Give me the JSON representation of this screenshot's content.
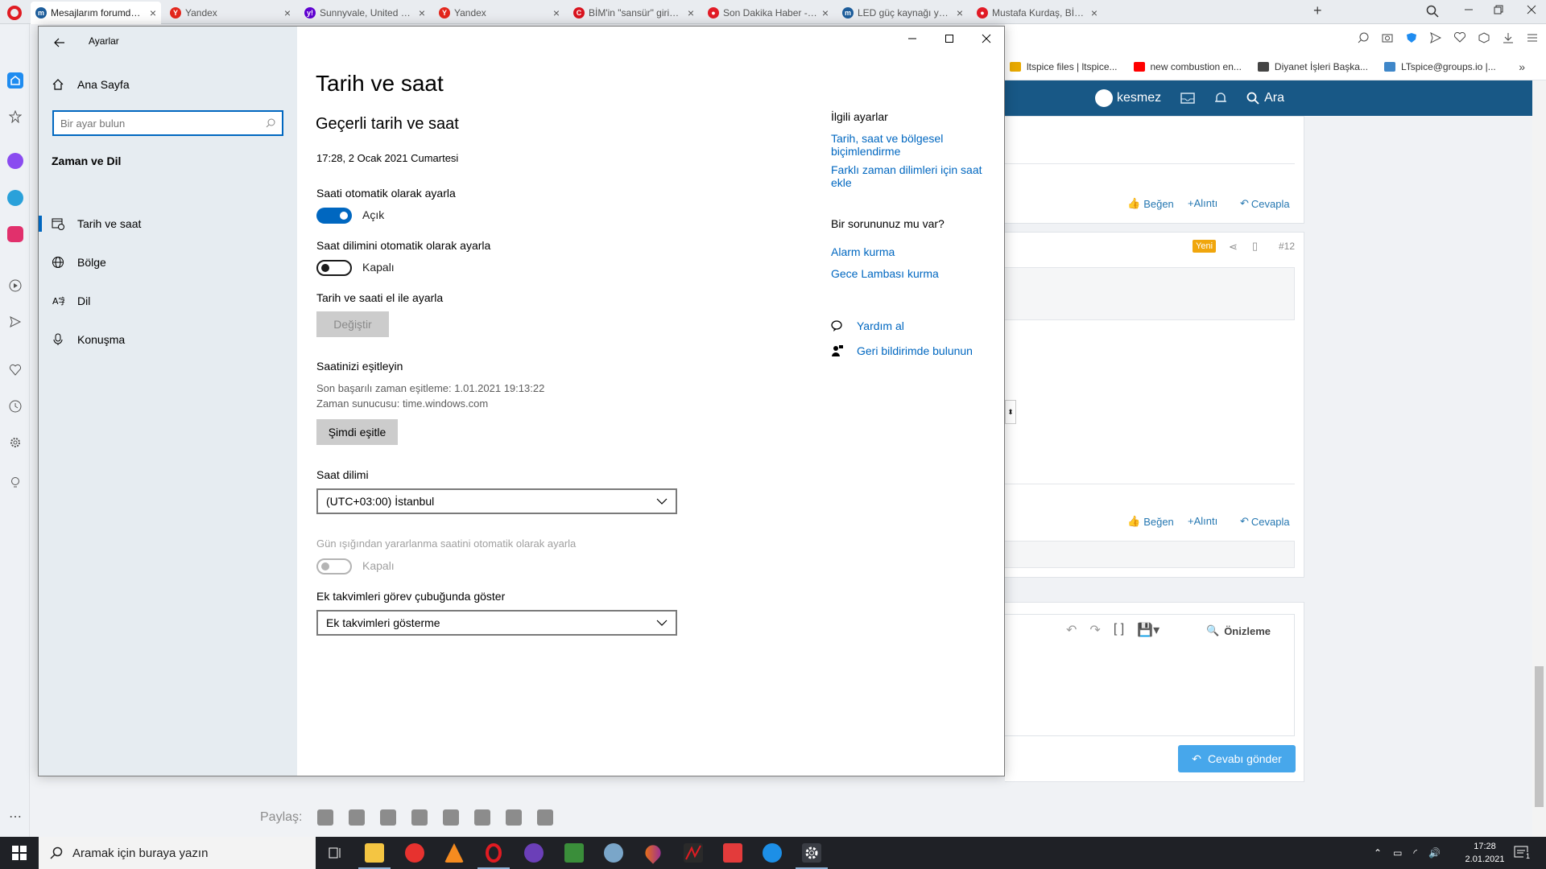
{
  "browser": {
    "tabs": [
      {
        "label": "Mesajlarım forumda geç gö",
        "active": true,
        "fav_color": "#1d5d9b",
        "fav_letter": "m"
      },
      {
        "label": "Yandex",
        "fav_color": "#e3261c",
        "fav_letter": "Y"
      },
      {
        "label": "Sunnyvale, United States - ",
        "fav_color": "#5f01d1",
        "fav_letter": "y!"
      },
      {
        "label": "Yandex",
        "fav_color": "#e3261c",
        "fav_letter": "Y"
      },
      {
        "label": "BİM'in \"sansür\" girişimi ifşa",
        "fav_color": "#d9131e",
        "fav_letter": "C"
      },
      {
        "label": "Son Dakika Haber - Milli Gaz",
        "fav_color": "#e21b26",
        "fav_letter": "●"
      },
      {
        "label": "LED güç kaynağı yapamam",
        "fav_color": "#1d5d9b",
        "fav_letter": "m"
      },
      {
        "label": "Mustafa Kurdaş, BİM'in san",
        "fav_color": "#e21b26",
        "fav_letter": "●"
      }
    ],
    "new_tab": "+",
    "bookmarks": [
      {
        "label": "ltspice files | ltspice...",
        "icon": "folder-icon",
        "color": "#e8a900"
      },
      {
        "label": "new combustion en...",
        "icon": "youtube-icon",
        "color": "#ff0000"
      },
      {
        "label": "Diyanet İşleri Başka...",
        "icon": "document-icon",
        "color": "#444444"
      },
      {
        "label": "LTspice@groups.io |...",
        "icon": "groups-icon",
        "color": "#3f87c9"
      }
    ]
  },
  "forum": {
    "user": "kesmez",
    "search_label": "Ara",
    "like": "Beğen",
    "quote": "+Alıntı",
    "reply": "Cevapla",
    "new_badge": "Yeni",
    "post_number": "#12",
    "preview": "Önizleme",
    "send_reply": "Cevabı gönder",
    "share_label": "Paylaş:",
    "brand_color": "#185886"
  },
  "settings": {
    "window_title": "Ayarlar",
    "home": "Ana Sayfa",
    "search_placeholder": "Bir ayar bulun",
    "section": "Zaman ve Dil",
    "nav": [
      {
        "label": "Tarih ve saat",
        "icon": "calendar-clock-icon",
        "selected": true
      },
      {
        "label": "Bölge",
        "icon": "globe-icon"
      },
      {
        "label": "Dil",
        "icon": "language-icon"
      },
      {
        "label": "Konuşma",
        "icon": "microphone-icon"
      }
    ],
    "page_title": "Tarih ve saat",
    "current_heading": "Geçerli tarih ve saat",
    "current_value": "17:28, 2 Ocak 2021 Cumartesi",
    "auto_time_label": "Saati otomatik olarak ayarla",
    "auto_time_state": "Açık",
    "auto_tz_label": "Saat dilimini otomatik olarak ayarla",
    "auto_tz_state": "Kapalı",
    "manual_label": "Tarih ve saati el ile ayarla",
    "change_button": "Değiştir",
    "sync_heading": "Saatinizi eşitleyin",
    "last_sync": "Son başarılı zaman eşitleme:  1.01.2021 19:13:22",
    "time_server": "Zaman sunucusu:  time.windows.com",
    "sync_button": "Şimdi eşitle",
    "tz_label": "Saat dilimi",
    "tz_value": "(UTC+03:00) İstanbul",
    "dst_label": "Gün ışığından yararlanma saatini otomatik olarak ayarla",
    "dst_state": "Kapalı",
    "calendars_label": "Ek takvimleri görev çubuğunda göster",
    "calendars_value": "Ek takvimleri gösterme",
    "related_heading": "İlgili ayarlar",
    "related_links": [
      "Tarih, saat ve bölgesel biçimlendirme",
      "Farklı zaman dilimleri için saat ekle"
    ],
    "question_heading": "Bir sorununuz mu var?",
    "question_links": [
      "Alarm kurma",
      "Gece Lambası kurma"
    ],
    "help": "Yardım al",
    "feedback": "Geri bildirimde bulunun",
    "accent": "#0067c0"
  },
  "taskbar": {
    "search_placeholder": "Aramak için buraya yazın",
    "time": "17:28",
    "date": "2.01.2021",
    "notifications": "1"
  }
}
